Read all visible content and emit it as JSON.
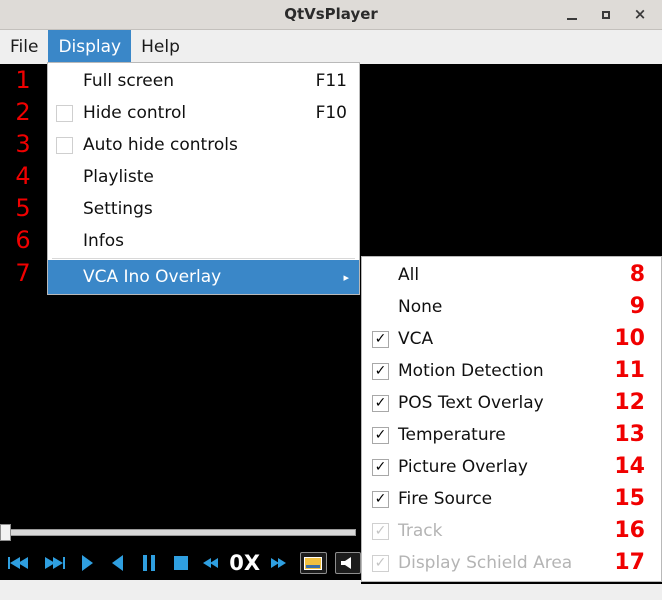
{
  "window": {
    "title": "QtVsPlayer",
    "buttons": {
      "minimize": "minimize-button",
      "maximize": "maximize-button",
      "close": "×"
    }
  },
  "menubar": {
    "items": [
      {
        "label": "File",
        "active": false
      },
      {
        "label": "Display",
        "active": true
      },
      {
        "label": "Help",
        "active": false
      }
    ]
  },
  "display_menu": {
    "items": [
      {
        "num": "1",
        "label": "Full screen",
        "shortcut": "F11",
        "checkbox": false,
        "checked": false,
        "selected": false,
        "submenu": false
      },
      {
        "num": "2",
        "label": "Hide control",
        "shortcut": "F10",
        "checkbox": true,
        "checked": false,
        "selected": false,
        "submenu": false
      },
      {
        "num": "3",
        "label": "Auto hide controls",
        "shortcut": "",
        "checkbox": true,
        "checked": false,
        "selected": false,
        "submenu": false
      },
      {
        "num": "4",
        "label": "Playliste",
        "shortcut": "",
        "checkbox": false,
        "checked": false,
        "selected": false,
        "submenu": false
      },
      {
        "num": "5",
        "label": "Settings",
        "shortcut": "",
        "checkbox": false,
        "checked": false,
        "selected": false,
        "submenu": false
      },
      {
        "num": "6",
        "label": "Infos",
        "shortcut": "",
        "checkbox": false,
        "checked": false,
        "selected": false,
        "submenu": false
      },
      {
        "num": "7",
        "label": "VCA Ino Overlay",
        "shortcut": "",
        "checkbox": false,
        "checked": false,
        "selected": true,
        "submenu": true
      }
    ],
    "submenu_arrow": "▸"
  },
  "vca_submenu": {
    "items": [
      {
        "num": "8",
        "label": "All",
        "checkbox": false,
        "checked": false,
        "disabled": false
      },
      {
        "num": "9",
        "label": "None",
        "checkbox": false,
        "checked": false,
        "disabled": false
      },
      {
        "num": "10",
        "label": "VCA",
        "checkbox": true,
        "checked": true,
        "disabled": false
      },
      {
        "num": "11",
        "label": "Motion Detection",
        "checkbox": true,
        "checked": true,
        "disabled": false
      },
      {
        "num": "12",
        "label": "POS Text Overlay",
        "checkbox": true,
        "checked": true,
        "disabled": false
      },
      {
        "num": "13",
        "label": "Temperature",
        "checkbox": true,
        "checked": true,
        "disabled": false
      },
      {
        "num": "14",
        "label": "Picture Overlay",
        "checkbox": true,
        "checked": true,
        "disabled": false
      },
      {
        "num": "15",
        "label": "Fire Source",
        "checkbox": true,
        "checked": true,
        "disabled": false
      },
      {
        "num": "16",
        "label": "Track",
        "checkbox": true,
        "checked": true,
        "disabled": true
      },
      {
        "num": "17",
        "label": "Display Schield Area",
        "checkbox": true,
        "checked": true,
        "disabled": true
      }
    ],
    "check_glyph": "✓"
  },
  "controls": {
    "seek_position_percent": 0,
    "speed_label": "0X",
    "buttons": [
      {
        "name": "skip-backward-icon",
        "icon": "skip-back"
      },
      {
        "name": "skip-forward-icon",
        "icon": "skip-forward"
      },
      {
        "name": "play-icon",
        "icon": "play"
      },
      {
        "name": "play-reverse-icon",
        "icon": "play-reverse"
      },
      {
        "name": "pause-icon",
        "icon": "pause"
      },
      {
        "name": "stop-icon",
        "icon": "stop"
      },
      {
        "name": "speed-decrease-icon",
        "icon": "rewind"
      },
      {
        "name": "speed-increase-icon",
        "icon": "fast-forward"
      },
      {
        "name": "snapshot-button",
        "icon": "snapshot"
      },
      {
        "name": "volume-button",
        "icon": "speaker"
      }
    ]
  },
  "colors": {
    "highlight": "#3a87c8",
    "annotation": "#f00000",
    "control_icon": "#2f9fe0",
    "titlebar": "#dedbd7",
    "video": "#000000"
  }
}
